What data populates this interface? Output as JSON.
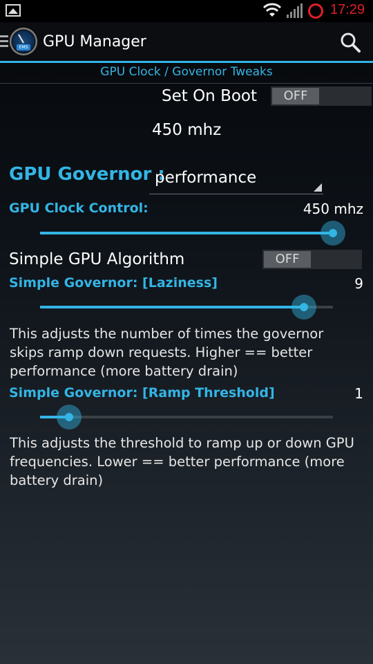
{
  "status_bar": {
    "time": "17:29",
    "time_color": "#e0202a"
  },
  "app_bar": {
    "title": "GPU Manager",
    "logo_tag": "EMS"
  },
  "section": {
    "title": "GPU Clock / Governor Tweaks"
  },
  "set_on_boot": {
    "label": "Set On Boot",
    "toggle": "OFF"
  },
  "current_freq": "450 mhz",
  "governor": {
    "label": "GPU Governor :",
    "selected": "performance"
  },
  "clock_control": {
    "label": "GPU Clock Control:",
    "value": "450 mhz",
    "level_fraction": 1.0
  },
  "simple_algorithm": {
    "label": "Simple GPU Algorithm",
    "toggle": "OFF"
  },
  "laziness": {
    "label": "Simple Governor: [Laziness]",
    "value": "9",
    "level_fraction": 0.9,
    "description": "This adjusts the number of times the governor skips ramp down requests. Higher == better performance (more battery drain)"
  },
  "ramp_threshold": {
    "label": "Simple Governor: [Ramp Threshold]",
    "value": "1",
    "level_fraction": 0.1,
    "description": "This adjusts the threshold to ramp up or down GPU frequencies. Lower == better performance (more battery drain)"
  },
  "colors": {
    "accent": "#33b5e5",
    "status_red": "#e0202a"
  }
}
